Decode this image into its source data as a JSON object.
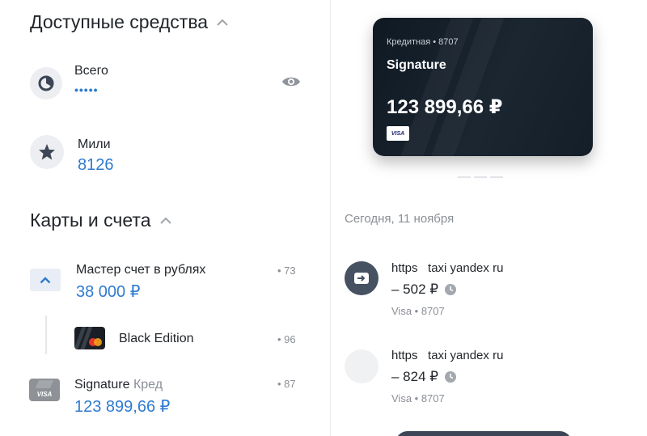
{
  "funds": {
    "title": "Доступные средства",
    "total_label": "Всего",
    "total_masked": "•••••",
    "miles_label": "Мили",
    "miles_value": "8126"
  },
  "cards_section": {
    "title": "Карты и счета",
    "accounts": [
      {
        "label": "Мастер счет в рублях",
        "value": "38 000 ₽",
        "suffix": "• 73"
      },
      {
        "label": "Black Edition",
        "suffix": "• 96"
      },
      {
        "label": "Signature",
        "label_extra": "Кред",
        "value": "123 899,66 ₽",
        "suffix": "• 87"
      }
    ]
  },
  "credit_card": {
    "type": "Кредитная • 8707",
    "name": "Signature",
    "balance": "123 899,66 ₽",
    "network": "VISA"
  },
  "transactions": {
    "date_header": "Сегодня, 11 ноября",
    "items": [
      {
        "title": "https   taxi yandex ru",
        "amount": "– 502 ₽",
        "sub": "Visa • 8707"
      },
      {
        "title": "https   taxi yandex ru",
        "amount": "– 824 ₽",
        "sub": "Visa • 8707"
      }
    ]
  },
  "colors": {
    "accent_blue": "#2f7bd0",
    "card_dark": "#141e28",
    "muted_gray": "#8a8f96"
  }
}
